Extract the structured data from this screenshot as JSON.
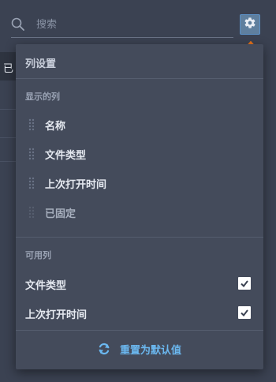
{
  "search": {
    "placeholder": "搜索"
  },
  "background": {
    "visible_fragment": "已"
  },
  "panel": {
    "title": "列设置",
    "shown_section_label": "显示的列",
    "shown_columns": [
      {
        "label": "名称"
      },
      {
        "label": "文件类型"
      },
      {
        "label": "上次打开时间"
      },
      {
        "label": "已固定"
      }
    ],
    "available_section_label": "可用列",
    "available_columns": [
      {
        "label": "文件类型",
        "checked": true
      },
      {
        "label": "上次打开时间",
        "checked": true
      }
    ],
    "reset_label": "重置为默认值"
  },
  "colors": {
    "accent": "#6bb8f0",
    "annotation_arrow": "#e8741c"
  },
  "icons": {
    "search": "search-icon",
    "settings": "gear-icon",
    "drag": "drag-handle-icon",
    "check": "check-icon",
    "reset": "refresh-icon",
    "annotation": "arrow-up-icon"
  }
}
